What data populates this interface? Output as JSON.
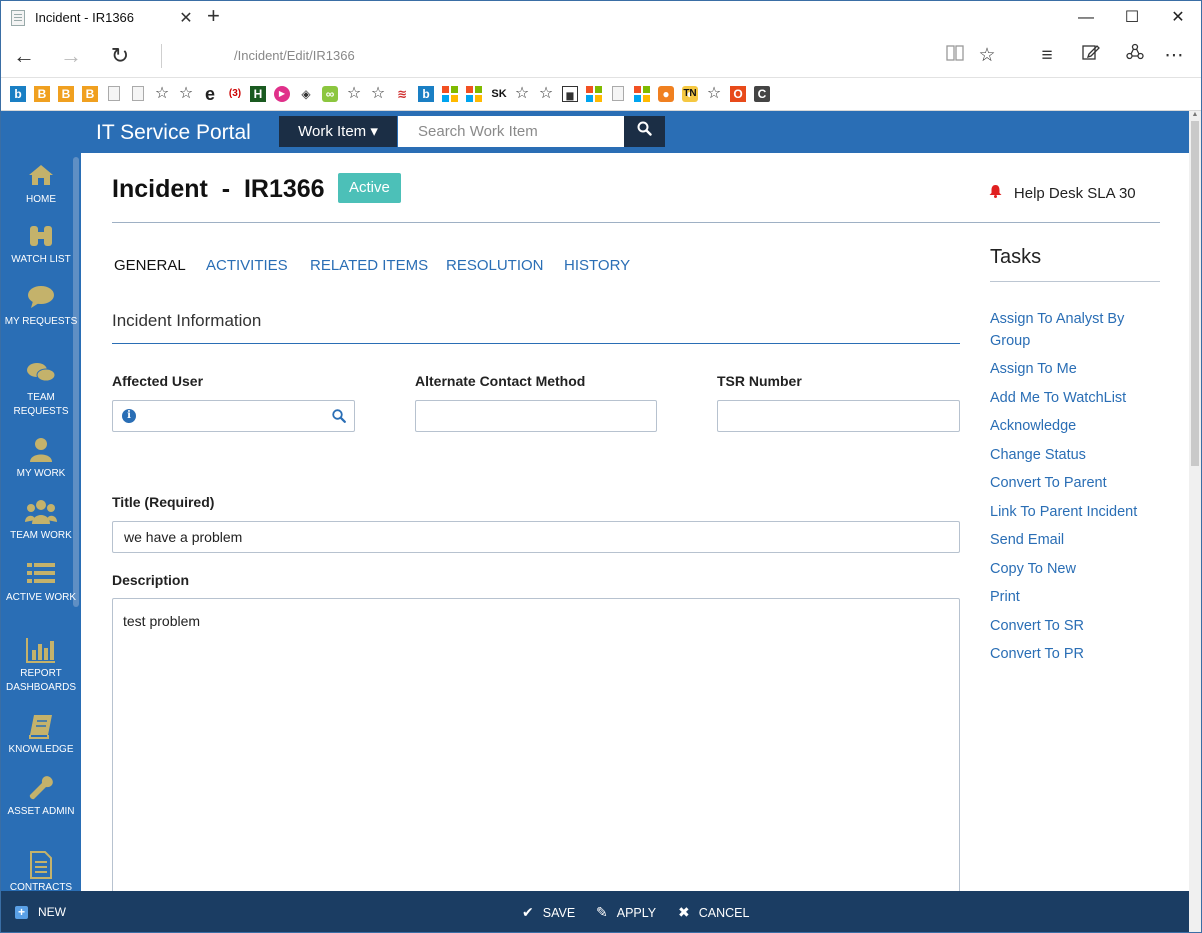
{
  "browser": {
    "tab_title": "Incident - IR1366",
    "tab_close": "✕",
    "new_tab": "+",
    "url_path": "/Incident/Edit/IR1366",
    "win_minimize": "—",
    "win_maximize": "☐",
    "win_close": "✕",
    "back": "←",
    "forward": "→",
    "refresh": "↻",
    "favorites_icons": [
      "bing-icon",
      "blogger-icon",
      "blogger-icon",
      "blogger-icon",
      "page-icon",
      "page-icon",
      "star-icon",
      "star-icon",
      "ie-icon",
      "three-icon",
      "h-icon",
      "play-icon",
      "diamond-icon",
      "chain-icon",
      "star-icon",
      "star-icon",
      "red-icon",
      "bing-icon",
      "windows-icon",
      "windows-icon",
      "sk-icon",
      "star-icon",
      "star-icon",
      "chart-icon",
      "windows-icon",
      "page-icon",
      "windows-icon",
      "orange-icon",
      "chat-icon",
      "tn-icon",
      "star-icon",
      "office-icon",
      "c-icon"
    ],
    "fav_sk": "SK",
    "fav_tn": "TN",
    "fav_h": "H",
    "fav_e": "e",
    "fav_3": "(3)"
  },
  "header": {
    "app_title": "IT Service Portal",
    "dropdown_label": "Work Item ▾",
    "search_placeholder": "Search Work Item"
  },
  "sidebar": {
    "items": [
      {
        "label": "HOME",
        "icon": "home-icon"
      },
      {
        "label": "WATCH LIST",
        "icon": "binoculars-icon"
      },
      {
        "label": "MY REQUESTS",
        "icon": "comment-icon"
      },
      {
        "label": "TEAM REQUESTS",
        "icon": "comments-icon"
      },
      {
        "label": "MY WORK",
        "icon": "user-icon"
      },
      {
        "label": "TEAM WORK",
        "icon": "users-icon"
      },
      {
        "label": "ACTIVE WORK",
        "icon": "list-icon"
      },
      {
        "label": "REPORT DASHBOARDS",
        "icon": "bar-chart-icon"
      },
      {
        "label": "KNOWLEDGE",
        "icon": "book-icon"
      },
      {
        "label": "ASSET ADMIN",
        "icon": "wrench-icon"
      },
      {
        "label": "CONTRACTS",
        "icon": "document-icon"
      }
    ],
    "new_label": "NEW"
  },
  "page": {
    "title": "Incident  -  IR1366",
    "status": "Active",
    "sla": "Help Desk SLA 30",
    "tabs": [
      "GENERAL",
      "ACTIVITIES",
      "RELATED ITEMS",
      "RESOLUTION",
      "HISTORY"
    ],
    "active_tab": "GENERAL",
    "section_title": "Incident Information",
    "fields": {
      "affected_user_label": "Affected User",
      "affected_user_value": "",
      "alternate_contact_label": "Alternate Contact Method",
      "alternate_contact_value": "",
      "tsr_label": "TSR Number",
      "tsr_value": "",
      "title_label": "Title (Required)",
      "title_value": "we have a problem",
      "description_label": "Description",
      "description_value": "test problem"
    }
  },
  "tasks": {
    "title": "Tasks",
    "items": [
      "Assign To Analyst By Group",
      "Assign To Me",
      "Add Me To WatchList",
      "Acknowledge",
      "Change Status",
      "Convert To Parent",
      "Link To Parent Incident",
      "Send Email",
      "Copy To New",
      "Print",
      "Convert To SR",
      "Convert To PR"
    ]
  },
  "actions": {
    "save": "SAVE",
    "apply": "APPLY",
    "cancel": "CANCEL"
  },
  "colors": {
    "brand_blue": "#2a6eb5",
    "dark_navy": "#1b2e45",
    "action_bar": "#1b3d63",
    "status_teal": "#4cc0b8",
    "nav_icon_gold": "#c4b26b"
  }
}
